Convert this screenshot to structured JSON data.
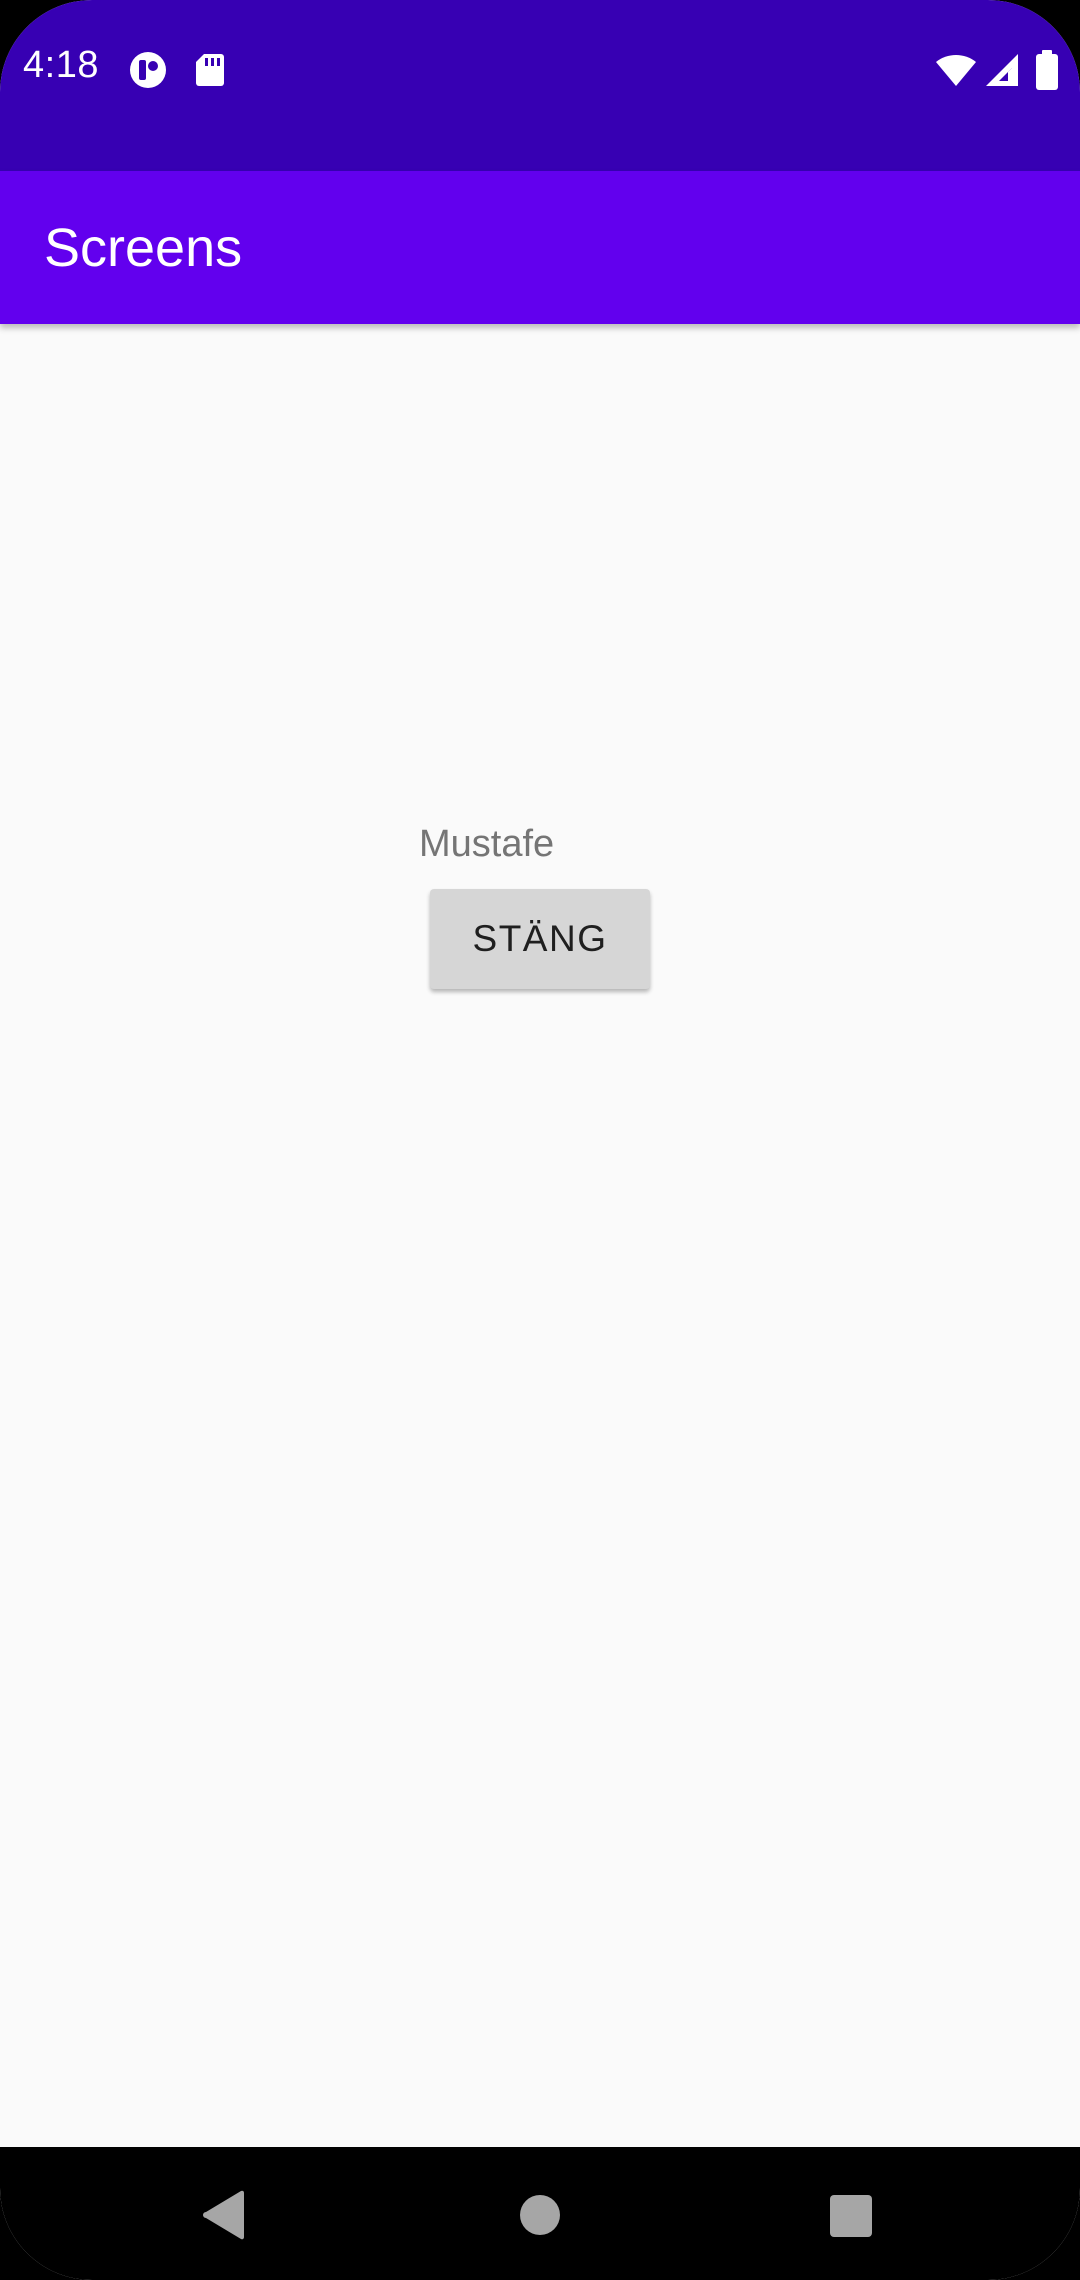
{
  "status_bar": {
    "time": "4:18",
    "left_icons": [
      "notification-app-icon",
      "sd-card-icon"
    ],
    "right_icons": [
      "wifi-icon",
      "cell-signal-icon",
      "battery-icon"
    ],
    "background_color": "#3700b3"
  },
  "app_bar": {
    "title": "Screens",
    "background_color": "#6200ee"
  },
  "content": {
    "name_label": "Mustafe",
    "close_button_label": "STÄNG"
  },
  "nav_bar": {
    "buttons": [
      "back-icon",
      "home-icon",
      "recents-icon"
    ]
  }
}
